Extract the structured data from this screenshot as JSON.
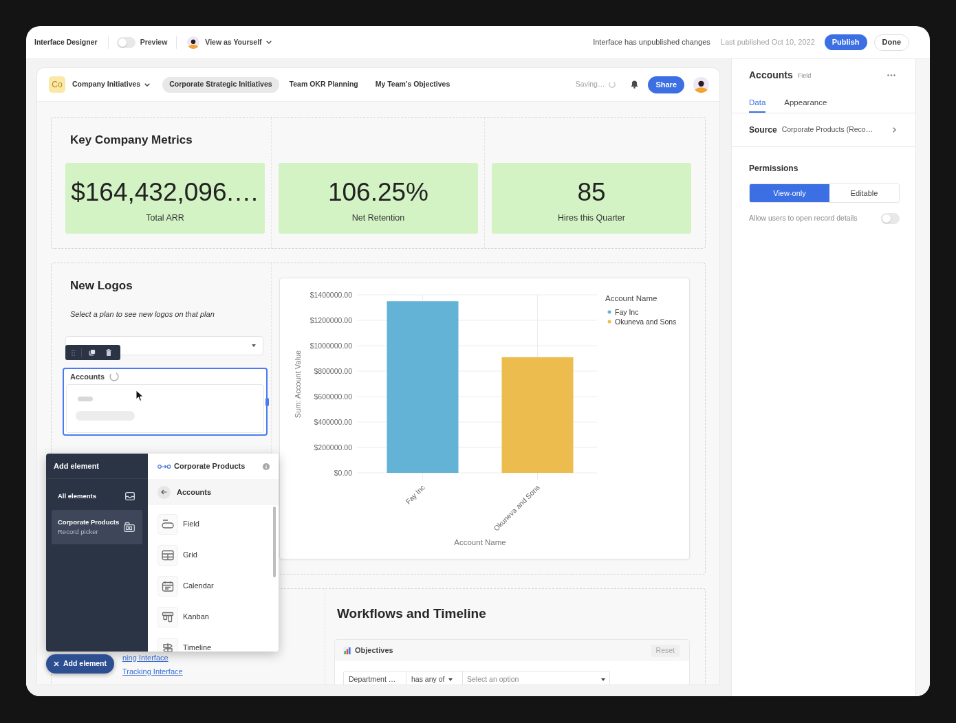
{
  "top_bar": {
    "title": "Interface Designer",
    "preview": {
      "label": "Preview",
      "on": false
    },
    "view_as": "View as Yourself",
    "status": "Interface has unpublished changes",
    "last_published": "Last published Oct 10, 2022",
    "buttons": [
      {
        "label": "Publish",
        "kind": "primary"
      },
      {
        "label": "Done",
        "kind": "secondary"
      }
    ]
  },
  "page_nav": {
    "badge": "Co",
    "app_menu": "Company Initiatives",
    "tabs": [
      {
        "label": "Corporate Strategic Initiatives",
        "selected": true
      },
      {
        "label": "Team OKR Planning",
        "selected": false
      },
      {
        "label": "My Team's Objectives",
        "selected": false
      }
    ],
    "saving": "Saving…",
    "share": "Share"
  },
  "metrics_section": {
    "title": "Key Company Metrics",
    "cards": [
      {
        "value": "$164,432,096.…",
        "label": "Total ARR"
      },
      {
        "value": "106.25%",
        "label": "Net Retention"
      },
      {
        "value": "85",
        "label": "Hires this Quarter"
      }
    ]
  },
  "new_logos_section": {
    "title": "New Logos",
    "description": "Select a plan to see new logos on that plan",
    "accounts_element": {
      "label": "Accounts",
      "selected": true
    }
  },
  "chart_card": {
    "legend_title": "Account Name",
    "chart_data": {
      "type": "bar",
      "xlabel": "Account Name",
      "ylabel": "Sum: Account Value",
      "categories": [
        "Fay Inc",
        "Okuneva and Sons"
      ],
      "series": [
        {
          "name": "Fay Inc",
          "color": "#63b3d6",
          "values": [
            1350000,
            null
          ]
        },
        {
          "name": "Okuneva and Sons",
          "color": "#ecbc4e",
          "values": [
            null,
            910000
          ]
        }
      ],
      "stacked": true,
      "grid": true,
      "ylim": [
        0,
        1400000
      ],
      "yticks": [
        {
          "value": 0,
          "label": "$0.00"
        },
        {
          "value": 200000,
          "label": "$200000.00"
        },
        {
          "value": 400000,
          "label": "$400000.00"
        },
        {
          "value": 600000,
          "label": "$600000.00"
        },
        {
          "value": 800000,
          "label": "$800000.00"
        },
        {
          "value": 1000000,
          "label": "$1000000.00"
        },
        {
          "value": 1200000,
          "label": "$1200000.00"
        },
        {
          "value": 1400000,
          "label": "$1400000.00"
        }
      ]
    }
  },
  "links": [
    {
      "label": "ning Interface"
    },
    {
      "label": "Tracking Interface"
    }
  ],
  "workflows_section": {
    "title": "Workflows and Timeline",
    "objectives": {
      "title": "Objectives",
      "reset": "Reset",
      "filter": {
        "field": "Department …",
        "operator": "has any of",
        "placeholder": "Select an option"
      }
    }
  },
  "add_element_menu": {
    "title": "Add element",
    "categories": [
      {
        "title": "All elements",
        "kind": "all",
        "selected": false
      },
      {
        "title": "Corporate Products",
        "subtitle": "Record picker",
        "kind": "source",
        "selected": true
      }
    ],
    "source": "Corporate Products",
    "back_label": "Accounts",
    "elements": [
      {
        "label": "Field",
        "kind": "field"
      },
      {
        "label": "Grid",
        "kind": "grid"
      },
      {
        "label": "Calendar",
        "kind": "calendar"
      },
      {
        "label": "Kanban",
        "kind": "kanban"
      },
      {
        "label": "Timeline",
        "kind": "timeline"
      }
    ]
  },
  "add_element_button": "Add element",
  "properties_panel": {
    "title": "Accounts",
    "subtitle": "Field",
    "tabs": [
      {
        "label": "Data",
        "selected": true
      },
      {
        "label": "Appearance",
        "selected": false
      }
    ],
    "source": {
      "label": "Source",
      "value": "Corporate Products (Reco…"
    },
    "permissions": {
      "title": "Permissions",
      "options": [
        {
          "label": "View-only",
          "selected": true
        },
        {
          "label": "Editable",
          "selected": false
        }
      ],
      "allow_open": {
        "label": "Allow users to open record details",
        "on": false
      }
    }
  }
}
